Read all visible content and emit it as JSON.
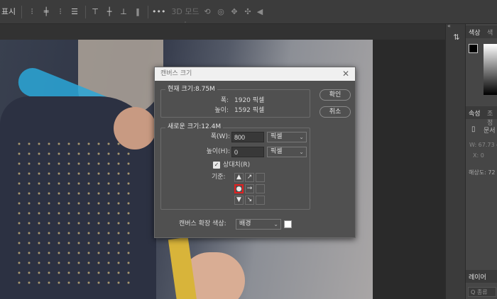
{
  "optionsbar": {
    "show_label": "표시",
    "more_label": "•••",
    "mode3d_label": "3D 모드 :",
    "icons": [
      "align-left-icon",
      "align-vcenter-icon",
      "align-right-icon",
      "distribute-icon",
      "align-top-icon",
      "align-middle-icon",
      "align-bottom-icon",
      "distribute-v-icon",
      "more-icon",
      "orbit-3d-icon",
      "roll-3d-icon",
      "drag-3d-icon",
      "slide-3d-icon",
      "scale-3d-icon"
    ]
  },
  "panels": {
    "tabs": [
      "색상",
      "색"
    ],
    "props_tab": "속성",
    "props_tab2": "조정",
    "doc_label": "문서",
    "w_label": "W: 67.73 c",
    "x_label": "X: 0",
    "resolution_label": "해상도: 72",
    "layers_tab": "레이어",
    "search_label": "Q 종류"
  },
  "dialog": {
    "title": "캔버스 크기",
    "current_size_label": "현재 크기:8.75M",
    "current_width_label": "폭:",
    "current_width_value": "1920 픽셀",
    "current_height_label": "높이:",
    "current_height_value": "1592 픽셀",
    "ok_label": "확인",
    "cancel_label": "취소",
    "new_size_label": "새로운 크기:12.4M",
    "width_label": "폭(W):",
    "width_value": "800",
    "width_unit": "픽셀",
    "height_label": "높이(H):",
    "height_value": "0",
    "height_unit": "픽셀",
    "relative_label": "상대치(R)",
    "anchor_label": "기준:",
    "extension_color_label": "캔버스 확장 색상:",
    "extension_color_value": "배경"
  },
  "colors": {
    "accent_red": "#e02020",
    "dialog_bg": "#505050",
    "swatch": "#ffffff"
  }
}
